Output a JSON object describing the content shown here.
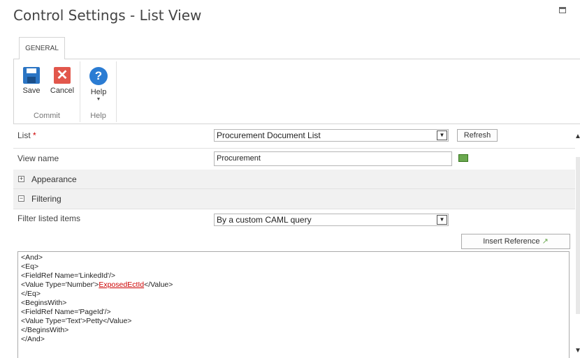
{
  "dialog": {
    "title": "Control Settings - List View"
  },
  "ribbon": {
    "tab": "GENERAL",
    "commit": {
      "save": "Save",
      "cancel": "Cancel",
      "group": "Commit"
    },
    "help": {
      "help": "Help",
      "group": "Help"
    }
  },
  "form": {
    "list": {
      "label": "List",
      "required": "*",
      "value": "Procurement Document List",
      "refresh": "Refresh"
    },
    "view_name": {
      "label": "View name",
      "value": "Procurement"
    },
    "appearance": {
      "toggle": "+",
      "title": "Appearance"
    },
    "filtering": {
      "toggle": "−",
      "title": "Filtering"
    },
    "filter_items": {
      "label": "Filter listed items",
      "value": "By a custom CAML query"
    },
    "insert_reference": "Insert Reference",
    "caml": {
      "l1": "<And>",
      "l2": "<Eq>",
      "l3": "<FieldRef Name='LinkedId'/>",
      "l4a": "<Value Type='Number'>",
      "l4ref": "ExposedEctId",
      "l4b": "</Value>",
      "l5": "</Eq>",
      "l6": "<BeginsWith>",
      "l7": "<FieldRef Name='PageId'/>",
      "l8": "<Value Type='Text'>Petty</Value>",
      "l9": "</BeginsWith>",
      "l10": "</And>"
    }
  },
  "icons": {
    "save": "save-icon",
    "cancel": "cancel-icon",
    "help": "help-icon",
    "maximize": "maximize-icon",
    "dropdown": "chevron-down-icon",
    "address_book": "address-book-icon"
  },
  "colors": {
    "accent": "#2b75c4",
    "cancel": "#e2574c",
    "required": "#cc0000",
    "reference": "#cc0000"
  }
}
